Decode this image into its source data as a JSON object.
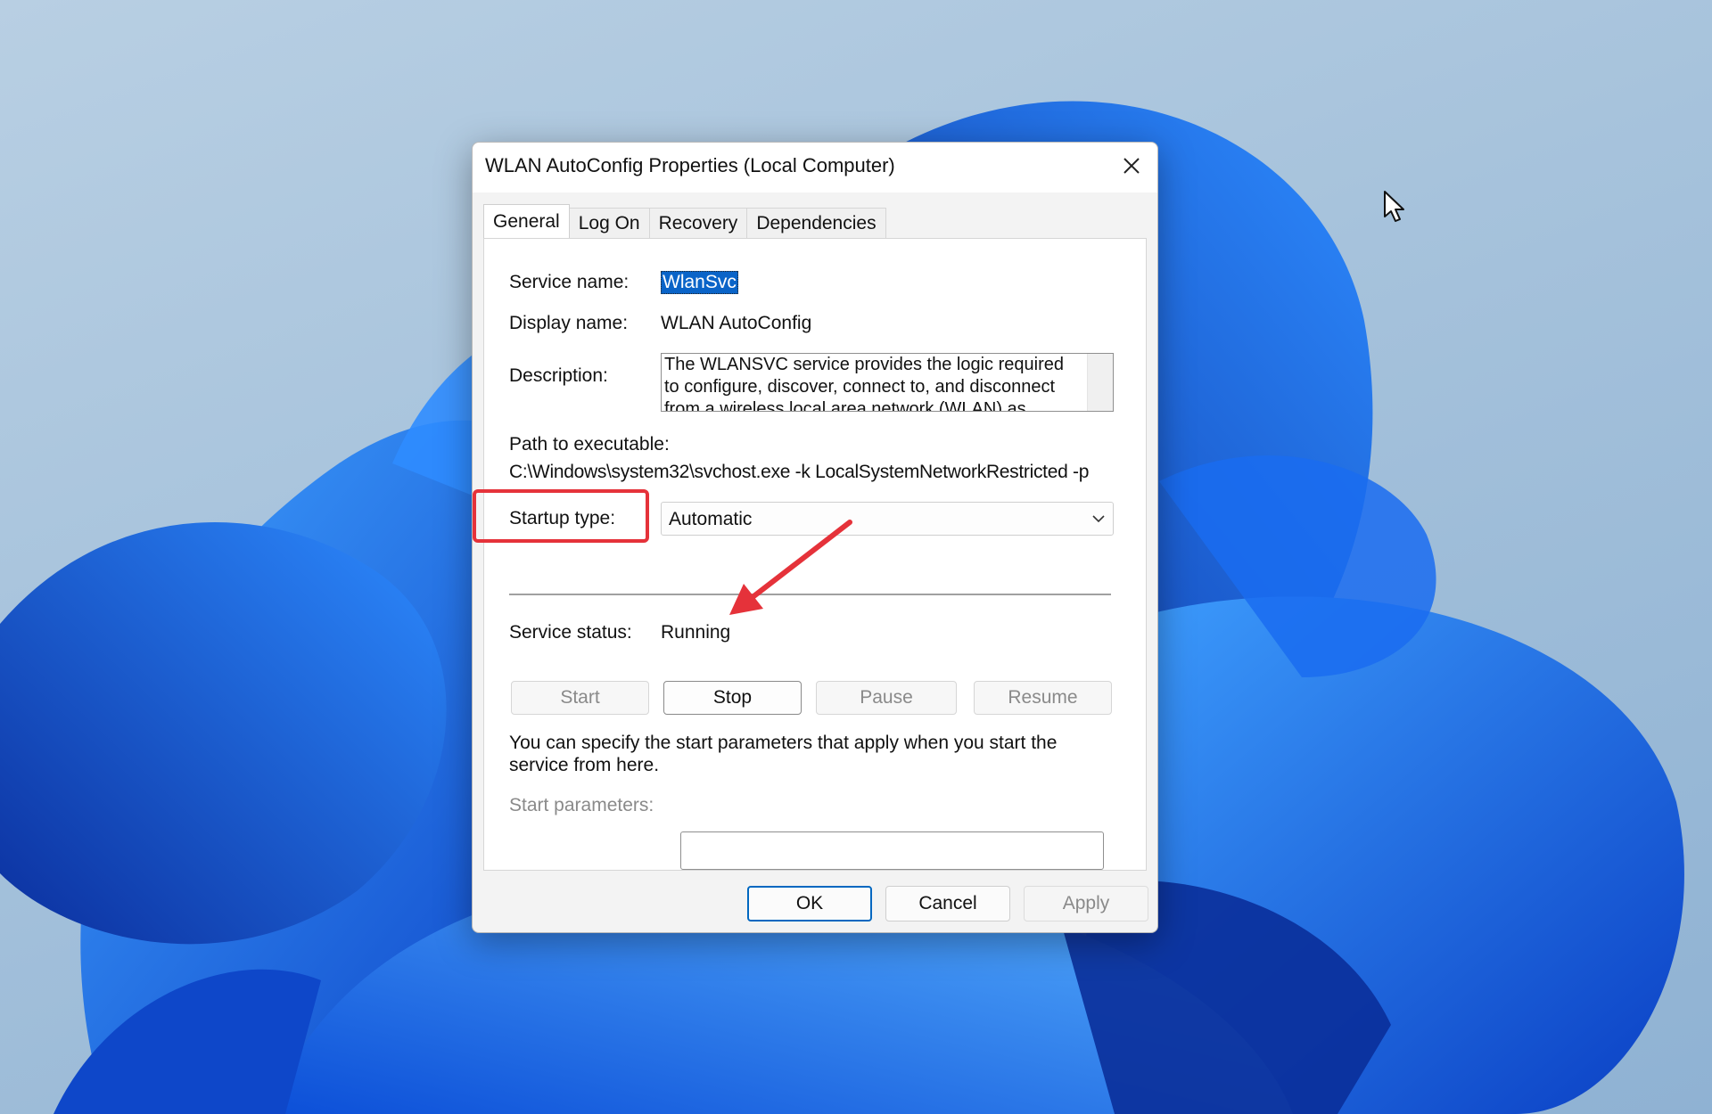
{
  "dialog": {
    "title": "WLAN AutoConfig Properties (Local Computer)",
    "tabs": [
      "General",
      "Log On",
      "Recovery",
      "Dependencies"
    ],
    "active_tab": "General"
  },
  "general": {
    "service_name_label": "Service name:",
    "service_name_value": "WlanSvc",
    "display_name_label": "Display name:",
    "display_name_value": "WLAN AutoConfig",
    "description_label": "Description:",
    "description_value": "The WLANSVC service provides the logic required to configure, discover, connect to, and disconnect from a wireless local area network (WLAN) as",
    "path_label": "Path to executable:",
    "path_value": "C:\\Windows\\system32\\svchost.exe -k LocalSystemNetworkRestricted -p",
    "startup_type_label": "Startup type:",
    "startup_type_value": "Automatic",
    "service_status_label": "Service status:",
    "service_status_value": "Running",
    "start_button": "Start",
    "stop_button": "Stop",
    "pause_button": "Pause",
    "resume_button": "Resume",
    "params_hint": "You can specify the start parameters that apply when you start the service from here.",
    "start_params_label": "Start parameters:",
    "start_params_value": ""
  },
  "footer": {
    "ok": "OK",
    "cancel": "Cancel",
    "apply": "Apply"
  },
  "annotation": {
    "highlight_color": "#e5323a"
  }
}
